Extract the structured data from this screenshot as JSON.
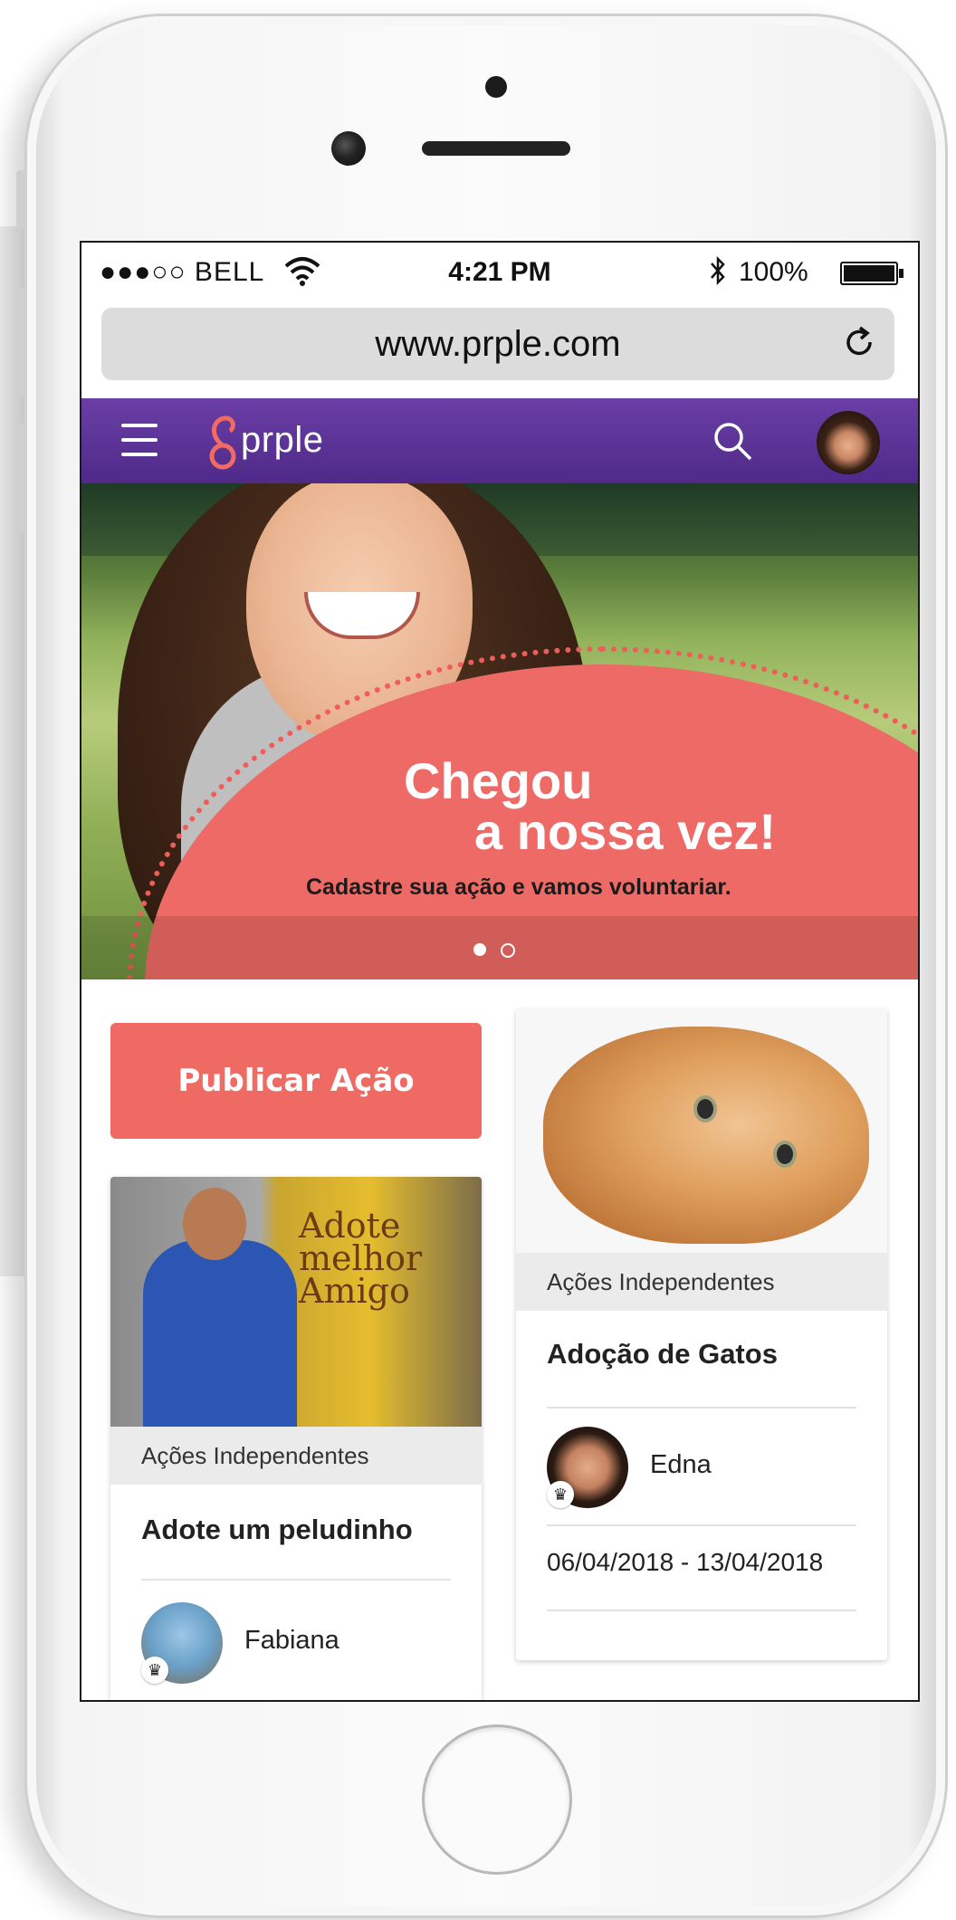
{
  "status_bar": {
    "carrier": "●●●○○ BELL",
    "time": "4:21 PM",
    "battery": "100%",
    "icons": [
      "wifi-icon",
      "bluetooth-icon",
      "battery-icon"
    ]
  },
  "browser": {
    "url": "www.prple.com",
    "icons": [
      "reload-icon"
    ]
  },
  "app_header": {
    "logo_text": "prple",
    "icons": [
      "menu-icon",
      "logo-icon",
      "search-icon",
      "avatar"
    ],
    "colors": {
      "bar": "#5a2f95",
      "logo_mark": "#f26b63"
    }
  },
  "hero": {
    "headline_line1": "Chegou",
    "headline_line2": "a nossa vez!",
    "subline": "Cadastre sua ação e vamos voluntariar.",
    "carousel": {
      "total": 2,
      "active": 1
    },
    "colors": {
      "bubble": "#ee6a66"
    }
  },
  "actions": {
    "publish_label": "Publicar Ação",
    "colors": {
      "publish": "#ef6a63"
    }
  },
  "cards": [
    {
      "category": "Ações Independentes",
      "title": "Adote um peludinho",
      "user": "Fabiana",
      "photo_text": "Adote melhor Amigo"
    },
    {
      "category": "Ações Independentes",
      "title": "Adoção de Gatos",
      "user": "Edna",
      "dates": "06/04/2018 - 13/04/2018"
    }
  ]
}
